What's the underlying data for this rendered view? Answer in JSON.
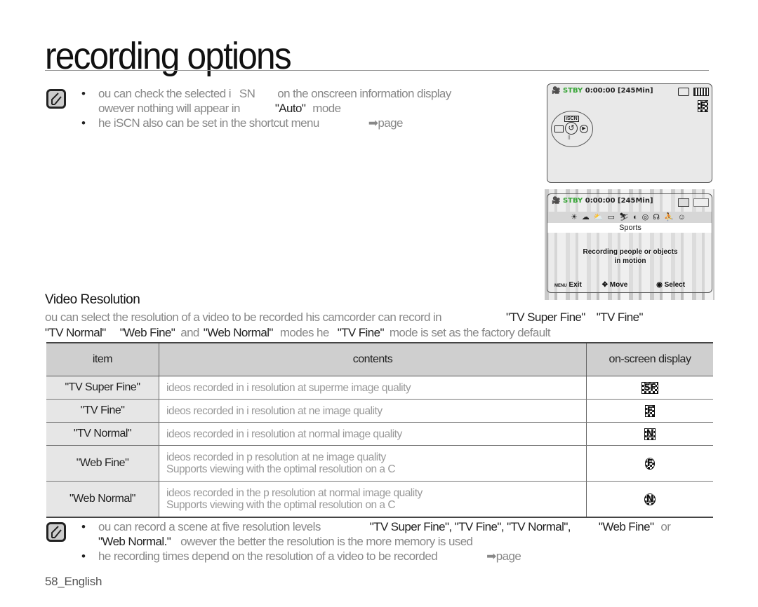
{
  "page": {
    "title": "recording options",
    "footer": "58_English"
  },
  "top_note": {
    "bullets": [
      {
        "parts": [
          "ou can check the selected i",
          "SN",
          "on the onscreen information display"
        ]
      },
      {
        "parts": [
          "owever nothing will appear in",
          "\"Auto\"",
          "mode"
        ]
      },
      {
        "parts": [
          "he iSCN also can be set in the shortcut menu",
          "➡page"
        ]
      }
    ]
  },
  "screen1": {
    "status": "STBY",
    "timecode": "0:00:00 [245Min]",
    "quality_badge": "F",
    "menu_wheel_label": "iSCN"
  },
  "screen2": {
    "status": "STBY",
    "timecode": "0:00:00 [245Min]",
    "scene_label": "Sports",
    "scene_desc_line1": "Recording people or objects",
    "scene_desc_line2": "in motion",
    "menu_key": "MENU",
    "exit_label": "Exit",
    "move_label": "Move",
    "select_label": "Select"
  },
  "section": {
    "heading": "Video Resolution",
    "para_line1": [
      "ou can select the resolution of a video to be recorded his camcorder can record in",
      "\"TV Super Fine\"",
      "\"TV Fine\""
    ],
    "para_line2": [
      "\"TV Normal\"",
      "\"Web Fine\"",
      "and",
      "\"Web Normal\"",
      "modes he",
      "\"TV Fine\"",
      "mode is set as the factory default"
    ]
  },
  "table": {
    "headers": {
      "item": "item",
      "contents": "contents",
      "display": "on-screen display"
    },
    "rows": [
      {
        "item": "\"TV Super Fine\"",
        "line1": "ideos recorded in i resolution at superme image quality",
        "line2": "",
        "badge": "SF",
        "shape": "square"
      },
      {
        "item": "\"TV Fine\"",
        "line1": "ideos recorded in i resolution at ne image quality",
        "line2": "",
        "badge": "F",
        "shape": "square"
      },
      {
        "item": "\"TV Normal\"",
        "line1": "ideos recorded in i resolution at normal image quality",
        "line2": "",
        "badge": "N",
        "shape": "square"
      },
      {
        "item": "\"Web Fine\"",
        "line1": "ideos recorded in p resolution at ne image quality",
        "line2": "Supports viewing with the optimal resolution on a C",
        "badge": "F",
        "shape": "round"
      },
      {
        "item": "\"Web Normal\"",
        "line1": "ideos recorded in the p resolution at normal image quality",
        "line2": "Supports viewing with the optimal resolution on a C",
        "badge": "N",
        "shape": "round"
      }
    ]
  },
  "bottom_note": {
    "line1": [
      "ou can record a scene at five resolution levels",
      "\"TV Super Fine\", \"TV Fine\", \"TV Normal\",",
      "\"Web Fine\"",
      "or"
    ],
    "line2": [
      "\"Web Normal.\"",
      "owever the better the resolution is the more memory is used"
    ],
    "line3": [
      "he recording times depend on the resolution of a video to be recorded",
      "➡page"
    ]
  }
}
